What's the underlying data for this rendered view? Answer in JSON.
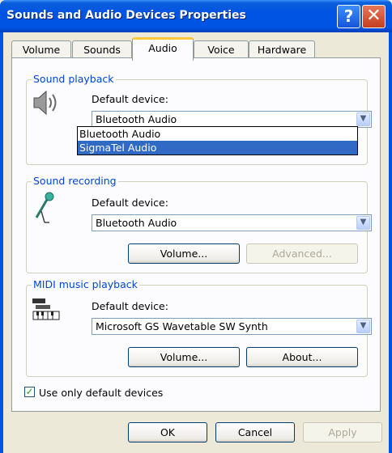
{
  "window": {
    "title": "Sounds and Audio Devices Properties"
  },
  "title_buttons": {
    "help": "?",
    "close": "✕"
  },
  "tabs": [
    "Volume",
    "Sounds",
    "Audio",
    "Voice",
    "Hardware"
  ],
  "active_tab": "Audio",
  "playback": {
    "group_label": "Sound playback",
    "default_label": "Default device:",
    "selected": "Bluetooth Audio",
    "icon": "speaker-icon",
    "dropdown_options": [
      "Bluetooth Audio",
      "SigmaTel Audio"
    ],
    "highlighted_option": "SigmaTel Audio"
  },
  "recording": {
    "group_label": "Sound recording",
    "default_label": "Default device:",
    "selected": "Bluetooth Audio",
    "icon": "microphone-icon",
    "volume_button": "Volume...",
    "advanced_button": "Advanced..."
  },
  "midi": {
    "group_label": "MIDI music playback",
    "default_label": "Default device:",
    "selected": "Microsoft GS Wavetable SW Synth",
    "icon": "midi-keyboard-icon",
    "volume_button": "Volume...",
    "about_button": "About..."
  },
  "use_default_only": {
    "label": "Use only default devices",
    "checked": true
  },
  "footer": {
    "ok": "OK",
    "cancel": "Cancel",
    "apply": "Apply"
  },
  "colors": {
    "titlebar": "#0054e3",
    "group_label": "#0046d5",
    "selection": "#316ac5",
    "tab_accent": "#ffc83c"
  }
}
